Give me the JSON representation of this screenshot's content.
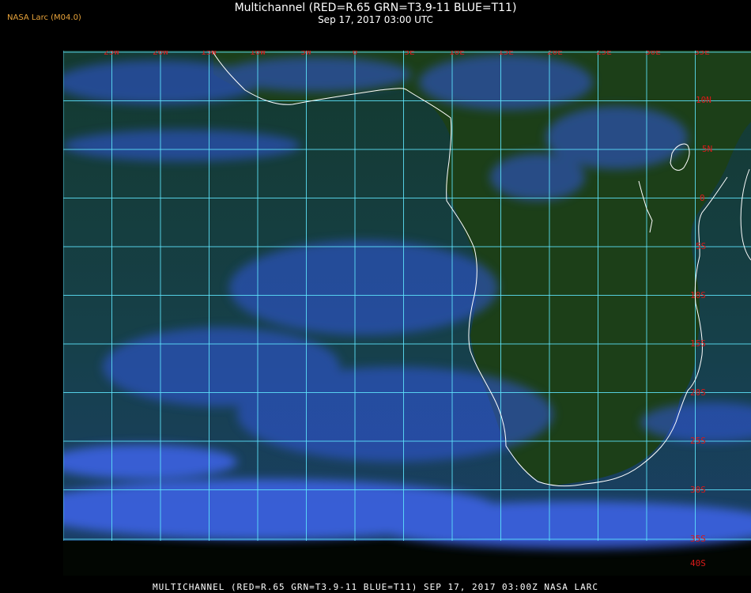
{
  "header": {
    "brand": "NASA Larc (M04.0)",
    "title": "Multichannel (RED=R.65 GRN=T3.9-11 BLUE=T11)",
    "subtitle": "Sep 17, 2017 03:00 UTC"
  },
  "footer": {
    "text": "MULTICHANNEL (RED=R.65 GRN=T3.9-11 BLUE=T11) SEP 17, 2017 03:00Z   NASA LARC"
  },
  "map": {
    "lon_labels": [
      "25W",
      "20W",
      "15W",
      "10W",
      "5W",
      "0",
      "5E",
      "10E",
      "15E",
      "20E",
      "25E",
      "30E",
      "35E"
    ],
    "lat_labels": [
      "10N",
      "5N",
      "0",
      "5S",
      "10S",
      "15S",
      "20S",
      "25S",
      "30S",
      "35S",
      "40S"
    ],
    "colors": {
      "ocean": "#173f3c",
      "land": "#1b3d17",
      "cloud": "#3a5ee8",
      "grid": "#5fe8ff",
      "label": "#d81a1a",
      "coast": "#ffffff"
    }
  }
}
